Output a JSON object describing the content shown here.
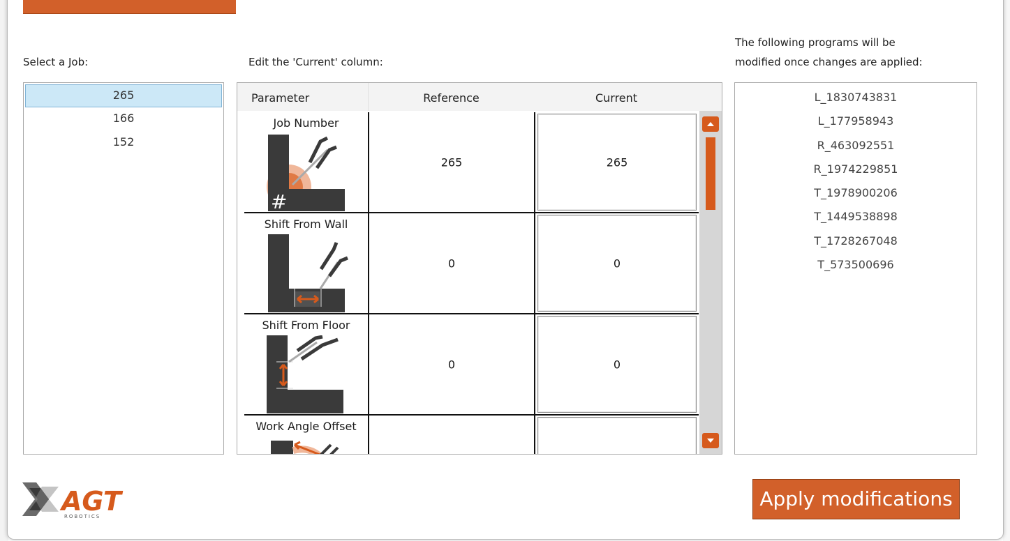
{
  "labels": {
    "select_job": "Select a Job:",
    "edit_current": "Edit the 'Current' column:",
    "programs_line1": "The following programs will be",
    "programs_line2": "modified once changes are applied:"
  },
  "jobs": [
    {
      "value": "265",
      "selected": true
    },
    {
      "value": "166",
      "selected": false
    },
    {
      "value": "152",
      "selected": false
    }
  ],
  "grid": {
    "headers": {
      "parameter": "Parameter",
      "reference": "Reference",
      "current": "Current"
    },
    "rows": [
      {
        "parameter": "Job Number",
        "reference": "265",
        "current": "265",
        "icon": "job-number-icon"
      },
      {
        "parameter": "Shift From Wall",
        "reference": "0",
        "current": "0",
        "icon": "shift-from-wall-icon"
      },
      {
        "parameter": "Shift From Floor",
        "reference": "0",
        "current": "0",
        "icon": "shift-from-floor-icon"
      },
      {
        "parameter": "Work Angle Offset",
        "reference": "",
        "current": "",
        "icon": "work-angle-offset-icon"
      }
    ]
  },
  "programs": [
    "L_1830743831",
    "L_177958943",
    "R_463092551",
    "R_1974229851",
    "T_1978900206",
    "T_1449538898",
    "T_1728267048",
    "T_573500696"
  ],
  "apply_button": "Apply modifications",
  "logo": {
    "text": "AGT",
    "subtext": "ROBOTICS"
  },
  "colors": {
    "accent": "#d2602a",
    "selection": "#cce8f7",
    "icon_dark": "#3a3a3a"
  }
}
